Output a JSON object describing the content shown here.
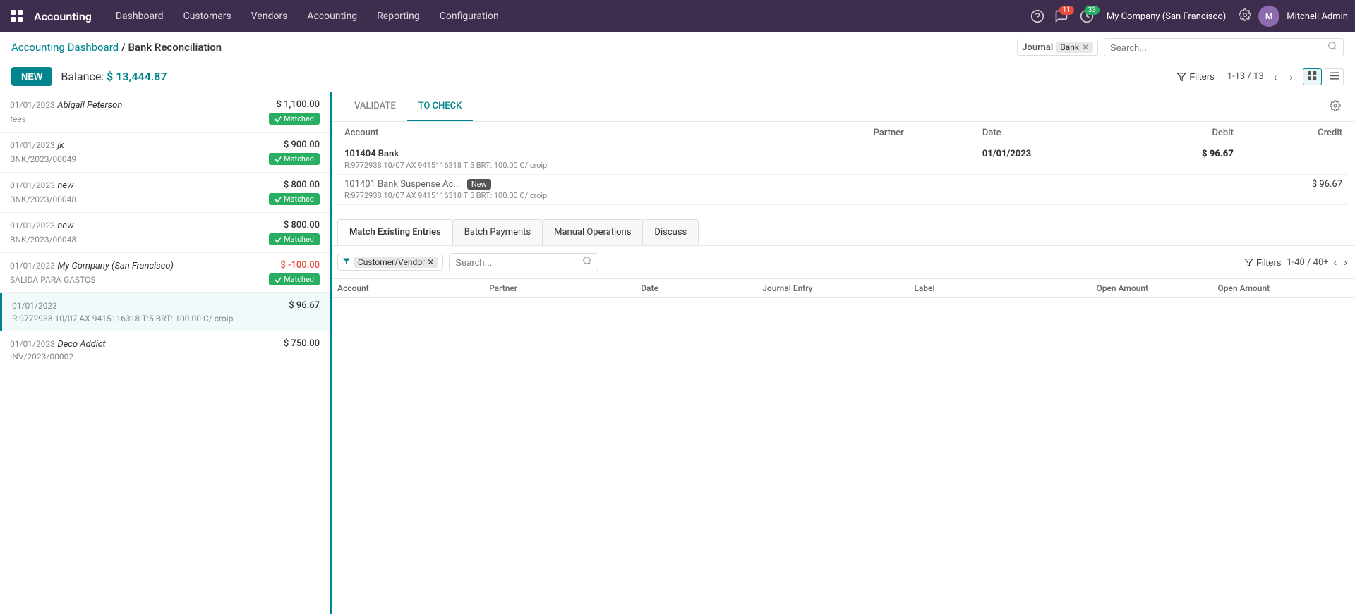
{
  "app": {
    "title": "Accounting",
    "grid_icon": "⊞"
  },
  "nav": {
    "items": [
      "Dashboard",
      "Customers",
      "Vendors",
      "Accounting",
      "Reporting",
      "Configuration"
    ]
  },
  "topbar": {
    "notifications_count": "11",
    "activity_count": "33",
    "company": "My Company (San Francisco)",
    "user": "Mitchell Admin"
  },
  "breadcrumb": {
    "parent": "Accounting Dashboard",
    "current": "Bank Reconciliation"
  },
  "journal_filter": {
    "label": "Journal",
    "value": "Bank"
  },
  "search": {
    "placeholder": "Search..."
  },
  "toolbar": {
    "new_label": "NEW",
    "balance_label": "Balance:",
    "balance_amount": "$ 13,444.87",
    "filter_label": "Filters",
    "pagination": "1-13 / 13"
  },
  "transactions": [
    {
      "date": "01/01/2023",
      "partner": "Abigail Peterson",
      "ref": "fees",
      "amount": "$ 1,100.00",
      "negative": false,
      "matched": true,
      "active": false
    },
    {
      "date": "01/01/2023",
      "partner": "jk",
      "ref": "BNK/2023/00049",
      "amount": "$ 900.00",
      "negative": false,
      "matched": true,
      "active": false
    },
    {
      "date": "01/01/2023",
      "partner": "new",
      "ref": "BNK/2023/00048",
      "amount": "$ 800.00",
      "negative": false,
      "matched": true,
      "active": false
    },
    {
      "date": "01/01/2023",
      "partner": "new",
      "ref": "BNK/2023/00048",
      "amount": "$ 800.00",
      "negative": false,
      "matched": true,
      "active": false
    },
    {
      "date": "01/01/2023",
      "partner": "My Company (San Francisco)",
      "ref": "SALIDA PARA GASTOS",
      "amount": "$ -100.00",
      "negative": true,
      "matched": true,
      "active": false
    },
    {
      "date": "01/01/2023",
      "partner": "",
      "ref": "R:9772938 10/07 AX 9415116318 T:5 BRT: 100.00 C/ croip",
      "amount": "$ 96.67",
      "negative": false,
      "matched": false,
      "active": true
    },
    {
      "date": "01/01/2023",
      "partner": "Deco Addict",
      "ref": "INV/2023/00002",
      "amount": "$ 750.00",
      "negative": false,
      "matched": false,
      "active": false
    }
  ],
  "check_tabs": {
    "validate_label": "VALIDATE",
    "to_check_label": "TO CHECK"
  },
  "journal_entries": {
    "columns": [
      "Account",
      "Partner",
      "Date",
      "Debit",
      "Credit"
    ],
    "rows": [
      {
        "account": "101404 Bank",
        "memo": "R:9772938 10/07 AX 9415116318 T:5 BRT: 100.00 C/ croip",
        "partner": "",
        "date": "01/01/2023",
        "debit": "$ 96.67",
        "credit": "",
        "bold": true,
        "is_new": false
      },
      {
        "account": "101401 Bank Suspense Ac...",
        "memo": "R:9772938 10/07 AX 9415116318 T:5 BRT: 100.00 C/ croip",
        "partner": "",
        "date": "",
        "debit": "",
        "credit": "$ 96.67",
        "bold": false,
        "is_new": true
      }
    ]
  },
  "match_tabs": {
    "items": [
      "Match Existing Entries",
      "Batch Payments",
      "Manual Operations",
      "Discuss"
    ],
    "active": 0
  },
  "match_filter": {
    "filter_label": "Customer/Vendor",
    "search_placeholder": "Search...",
    "filters_label": "Filters",
    "pagination": "1-40 / 40+"
  },
  "match_table": {
    "columns": [
      "Account",
      "Partner",
      "Date",
      "Journal Entry",
      "Label",
      "Open Amount",
      "Open Amount"
    ]
  },
  "matched_badge_label": "✓Matched"
}
